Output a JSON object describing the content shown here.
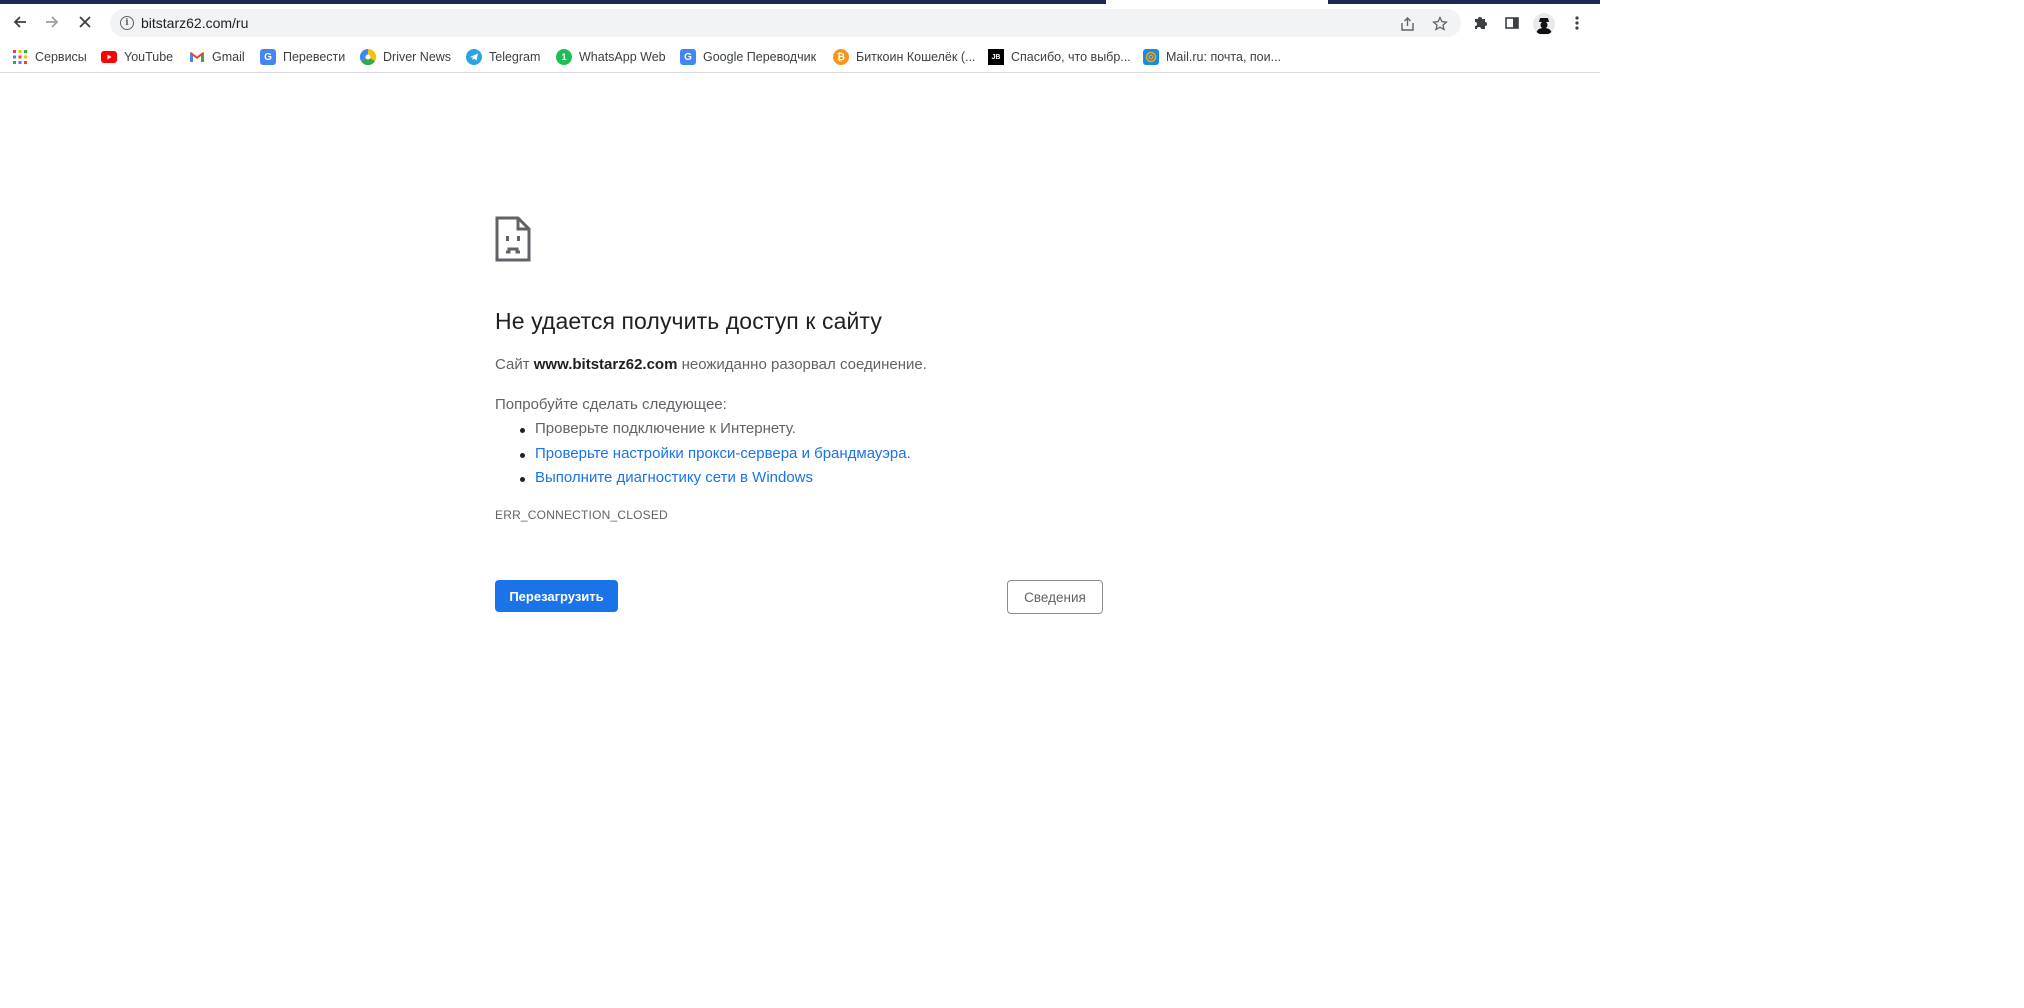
{
  "browser": {
    "address_bar": {
      "url": "bitstarz62.com/ru"
    },
    "bookmarks": [
      {
        "label": "Сервисы",
        "icon": "apps-grid-icon"
      },
      {
        "label": "YouTube",
        "icon": "youtube-icon",
        "color": "#ff0000"
      },
      {
        "label": "Gmail",
        "icon": "gmail-icon",
        "color": "#ea4335"
      },
      {
        "label": "Перевести",
        "icon": "google-translate-icon",
        "color": "#4285f4"
      },
      {
        "label": "Driver News",
        "icon": "driver-news-icon"
      },
      {
        "label": "Telegram",
        "icon": "telegram-icon",
        "color": "#2aa3df"
      },
      {
        "label": "WhatsApp Web",
        "icon": "whatsapp-icon",
        "color": "#1ebe57"
      },
      {
        "label": "Google Переводчик",
        "icon": "google-translate-icon",
        "color": "#4285f4"
      },
      {
        "label": "Биткоин Кошелёк (...",
        "icon": "bitcoin-icon",
        "color": "#f7931a"
      },
      {
        "label": "Спасибо, что выбр...",
        "icon": "jetbrains-icon",
        "color": "#000000"
      },
      {
        "label": "Mail.ru: почта, пои...",
        "icon": "mailru-icon",
        "color": "#168de2"
      }
    ]
  },
  "error_page": {
    "title": "Не удается получить доступ к сайту",
    "desc_prefix": "Сайт ",
    "site": "www.bitstarz62.com",
    "desc_suffix": " неожиданно разорвал соединение.",
    "try_label": "Попробуйте сделать следующее:",
    "suggestions": [
      {
        "text": "Проверьте подключение к Интернету.",
        "link": false
      },
      {
        "text": "Проверьте настройки прокси-сервера и брандмауэра.",
        "link": true
      },
      {
        "text": "Выполните диагностику сети в Windows",
        "link": true
      }
    ],
    "error_code": "ERR_CONNECTION_CLOSED",
    "reload_label": "Перезагрузить",
    "details_label": "Сведения",
    "accent": "#1a73e8"
  }
}
